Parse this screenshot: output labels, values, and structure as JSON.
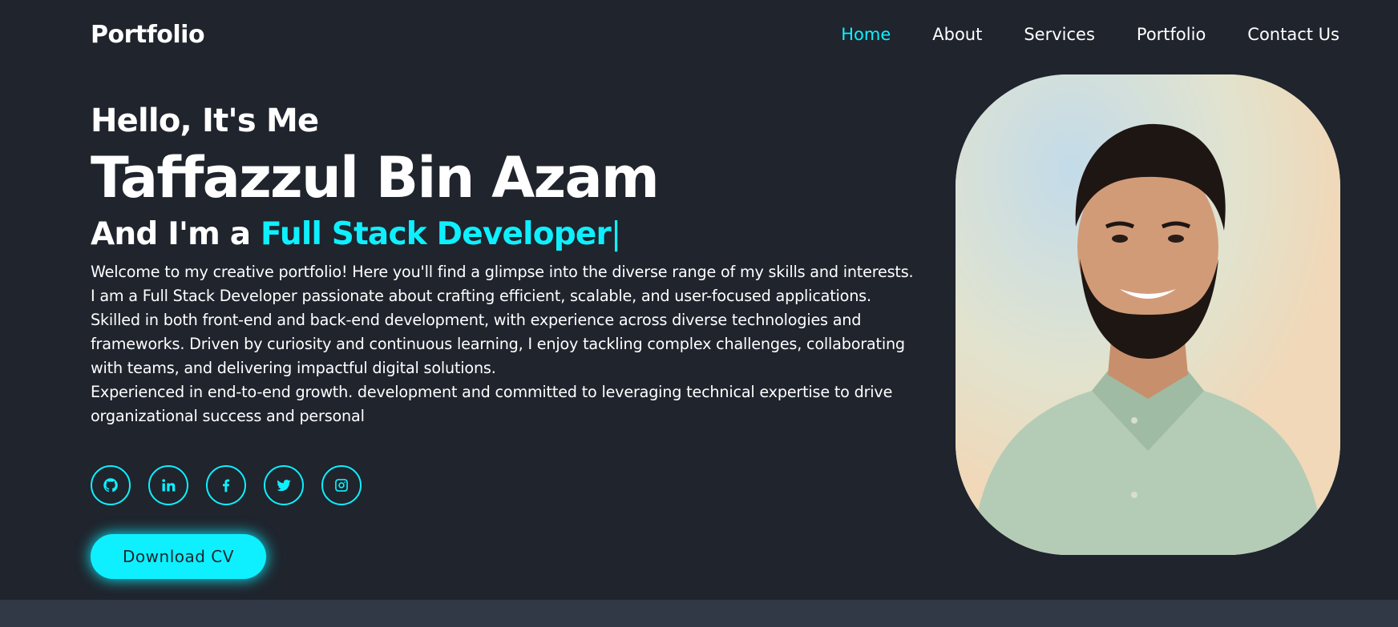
{
  "header": {
    "logo": "Portfolio",
    "nav": [
      {
        "label": "Home",
        "active": true
      },
      {
        "label": "About",
        "active": false
      },
      {
        "label": "Services",
        "active": false
      },
      {
        "label": "Portfolio",
        "active": false
      },
      {
        "label": "Contact Us",
        "active": false
      }
    ]
  },
  "hero": {
    "greeting": "Hello, It's Me",
    "name": "Taffazzul Bin Azam",
    "role_prefix": "And I'm a ",
    "role_highlight": "Full Stack Developer",
    "caret": "|",
    "description_lines": [
      "Welcome to my creative portfolio! Here you'll find a glimpse into the diverse range of my skills and interests.",
      "I am a Full Stack Developer passionate about crafting efficient, scalable, and user-focused applications.",
      "Skilled in both front-end and back-end development, with experience across diverse technologies and",
      "frameworks. Driven by curiosity and continuous learning, I enjoy tackling complex challenges, collaborating",
      "with teams, and delivering impactful digital solutions.",
      "Experienced in end-to-end growth. development and committed to leveraging technical expertise to drive",
      "organizational success and personal"
    ],
    "socials": [
      "github-icon",
      "linkedin-icon",
      "facebook-icon",
      "twitter-icon",
      "instagram-icon"
    ],
    "cv_button": "Download CV"
  },
  "colors": {
    "background": "#1f242d",
    "accent": "#0ef0ff",
    "band": "#323946"
  }
}
